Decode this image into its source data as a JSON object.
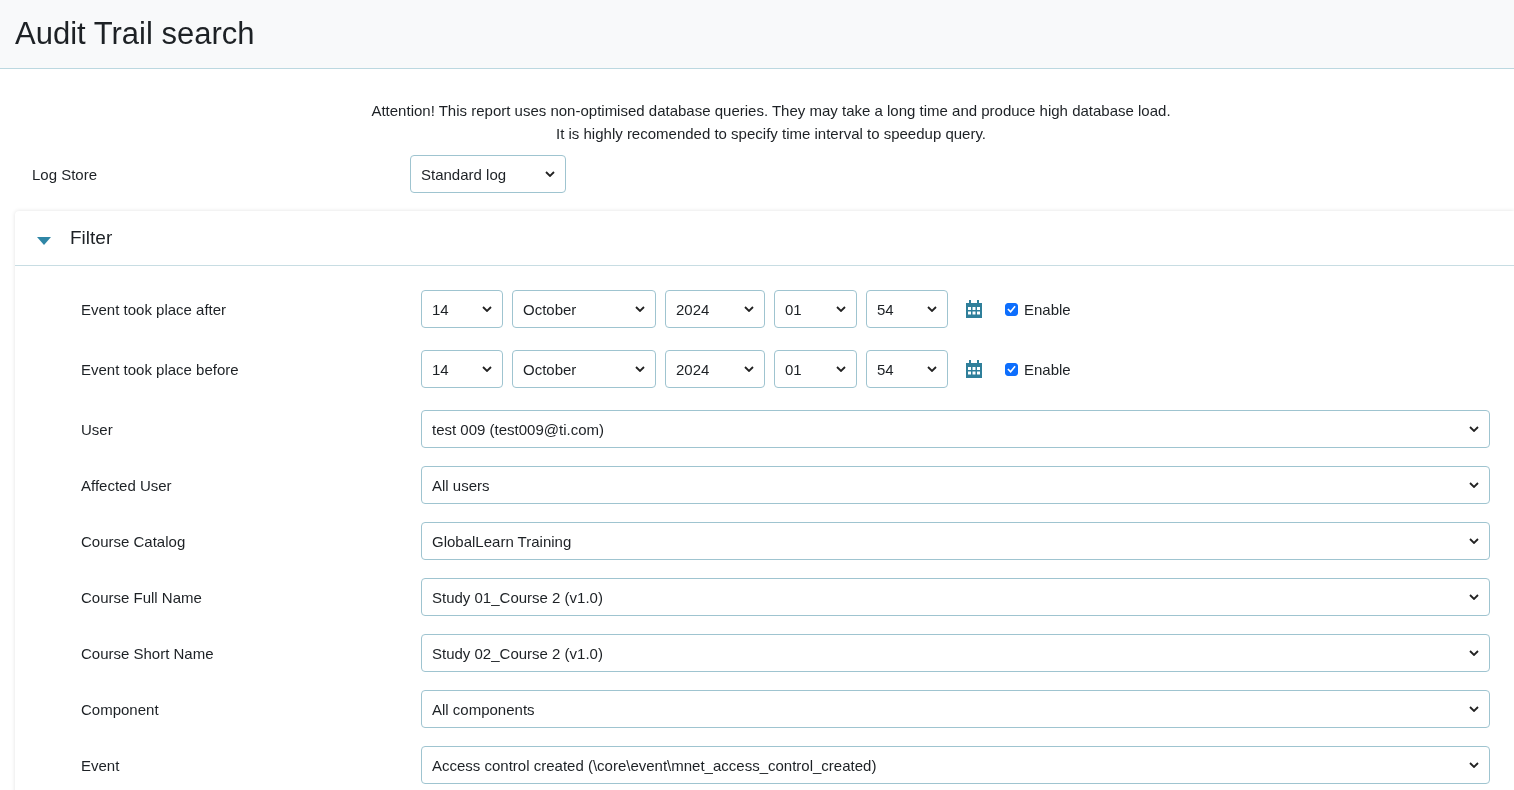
{
  "page": {
    "title": "Audit Trail search"
  },
  "notice": [
    "Attention! This report uses non-optimised database queries. They may take a long time and produce high database load.",
    "It is highly recomended to specify time interval to speedup query."
  ],
  "log_store": {
    "label": "Log Store",
    "value": "Standard log"
  },
  "filter": {
    "title": "Filter",
    "expanded": true,
    "date_rows": [
      {
        "label": "Event took place after",
        "parts": [
          "14",
          "October",
          "2024",
          "01",
          "54"
        ],
        "enable": {
          "label": "Enable",
          "checked": true
        }
      },
      {
        "label": "Event took place before",
        "parts": [
          "14",
          "October",
          "2024",
          "01",
          "54"
        ],
        "enable": {
          "label": "Enable",
          "checked": true
        }
      }
    ],
    "fields": [
      {
        "label": "User",
        "value": "test 009 (test009@ti.com)"
      },
      {
        "label": "Affected User",
        "value": "All users"
      },
      {
        "label": "Course Catalog",
        "value": "GlobalLearn Training"
      },
      {
        "label": "Course Full Name",
        "value": "Study 01_Course 2 (v1.0)"
      },
      {
        "label": "Course Short Name",
        "value": "Study 02_Course 2 (v1.0)"
      },
      {
        "label": "Component",
        "value": "All components"
      },
      {
        "label": "Event",
        "value": "Access control created (\\core\\event\\mnet_access_control_created)"
      }
    ]
  }
}
